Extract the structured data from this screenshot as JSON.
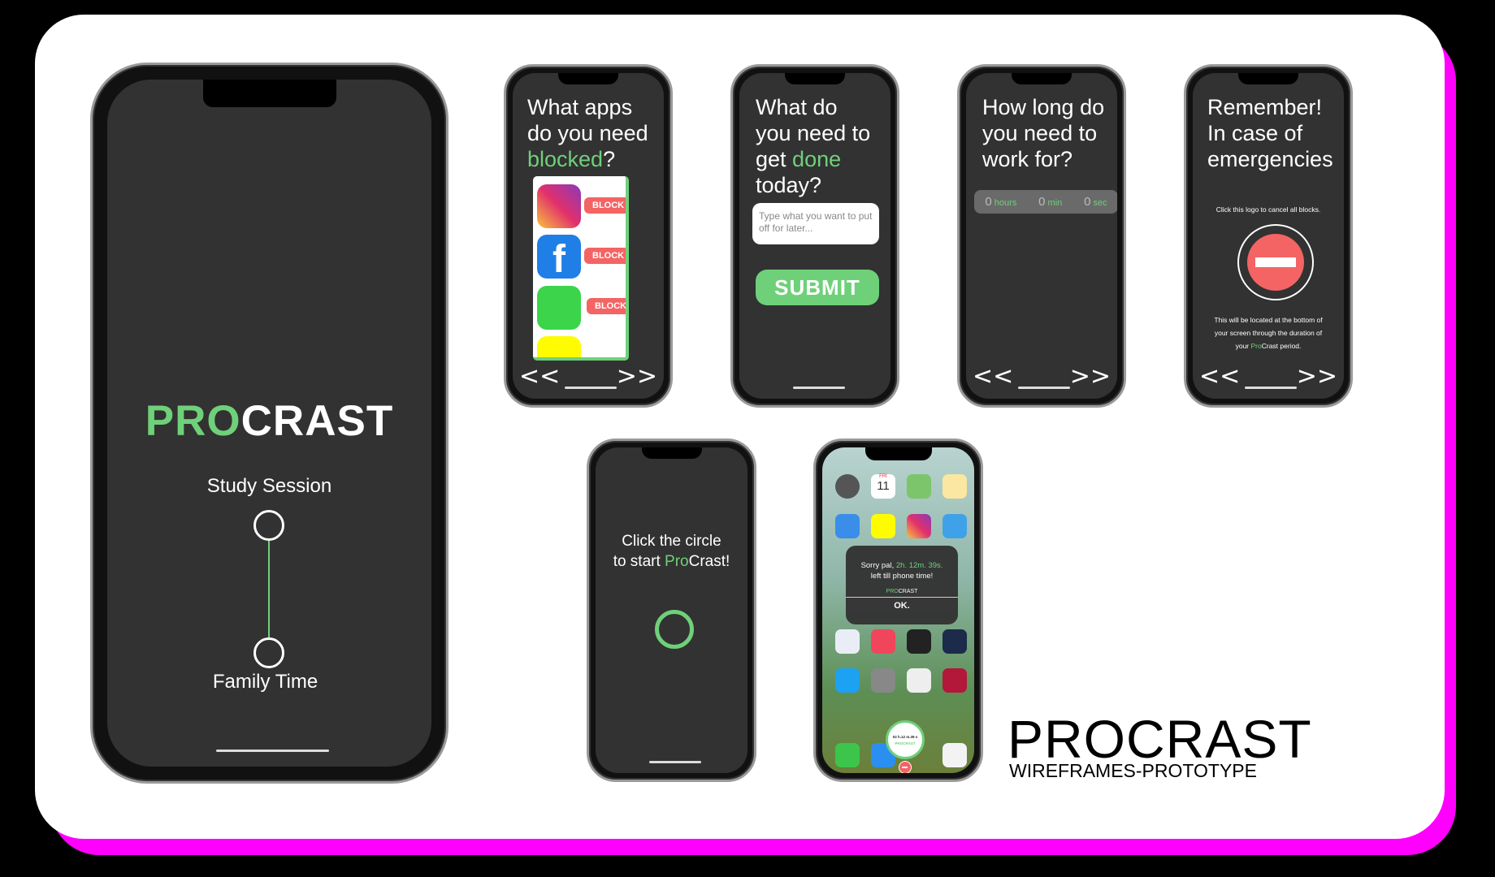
{
  "brand": {
    "title": "PROCRAST",
    "subtitle": "WIREFRAMES-PROTOTYPE"
  },
  "main_phone": {
    "logo_pro": "PRO",
    "logo_crast": "CRAST",
    "mode_top": "Study Session",
    "mode_bottom": "Family Time"
  },
  "apps_screen": {
    "title_1": "What apps",
    "title_2": "do you need",
    "title_green": "blocked",
    "title_end": "?",
    "apps": [
      {
        "name": "Instagram",
        "button": "BLOCK"
      },
      {
        "name": "Facebook",
        "button": "BLOCK"
      },
      {
        "name": "Messages",
        "button": "BLOCK"
      },
      {
        "name": "Snapchat"
      }
    ],
    "prev": "<<",
    "next": ">>"
  },
  "tasks_screen": {
    "title_1": "What do",
    "title_2": "you need to",
    "title_3a": "get ",
    "title_green": "done",
    "title_4": "today?",
    "input_placeholder": "Type what you want to put off for later...",
    "submit": "SUBMIT"
  },
  "duration_screen": {
    "title_1": "How long do",
    "title_2": "you need to",
    "title_3": "work for?",
    "hours_value": "0",
    "hours_label": "hours",
    "min_value": "0",
    "min_label": "min",
    "sec_value": "0",
    "sec_label": "sec",
    "prev": "<<",
    "next": ">>"
  },
  "emergency_screen": {
    "title_1": "Remember!",
    "title_2": "In case of",
    "title_3": "emergencies",
    "hint": "Click this logo to cancel all blocks.",
    "note_1": "This will be located at the bottom of",
    "note_2": "your screen through the duration of",
    "note_3a": "your ",
    "note_green": "Pro",
    "note_3b": "Crast period.",
    "prev": "<<",
    "next": ">>"
  },
  "start_screen": {
    "line_1": "Click the circle",
    "line_2a": "to start ",
    "line_green": "Pro",
    "line_2b": "Crast!"
  },
  "home_screen": {
    "calendar_day": "FRI",
    "calendar_date": "11",
    "alert_text_a": "Sorry pal, ",
    "alert_time": "2h. 12m. 39s.",
    "alert_text_b": "left till phone time!",
    "alert_logo_pro": "PRO",
    "alert_logo_crast": "CRAST",
    "alert_ok": "OK.",
    "timer_text": "02 h.12 m.39 s",
    "timer_logo": "PROCRAST"
  },
  "colors": {
    "green": "#6fd07a",
    "red": "#f46464",
    "magenta": "#ff00ff",
    "screen": "#323232"
  }
}
